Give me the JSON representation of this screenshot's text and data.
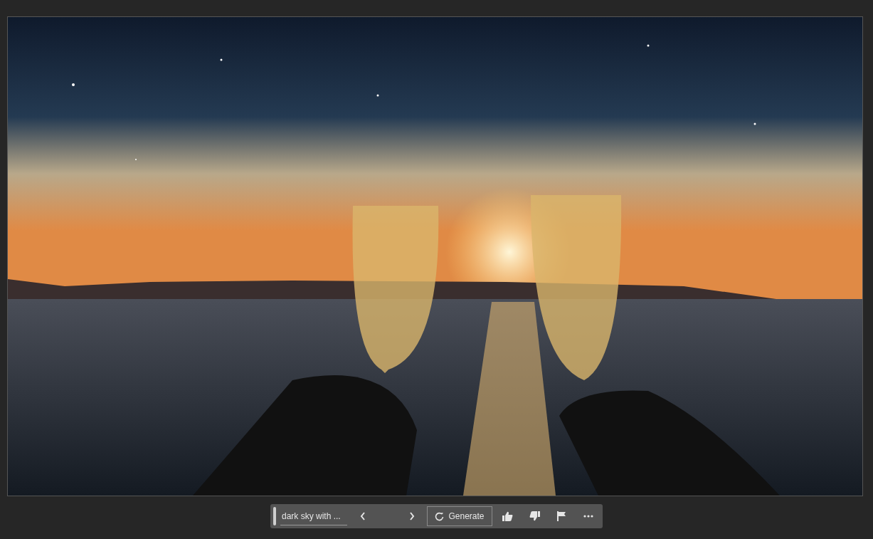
{
  "contextual_task_bar": {
    "prompt": "dark sky with ...",
    "generate_button": "Generate"
  }
}
